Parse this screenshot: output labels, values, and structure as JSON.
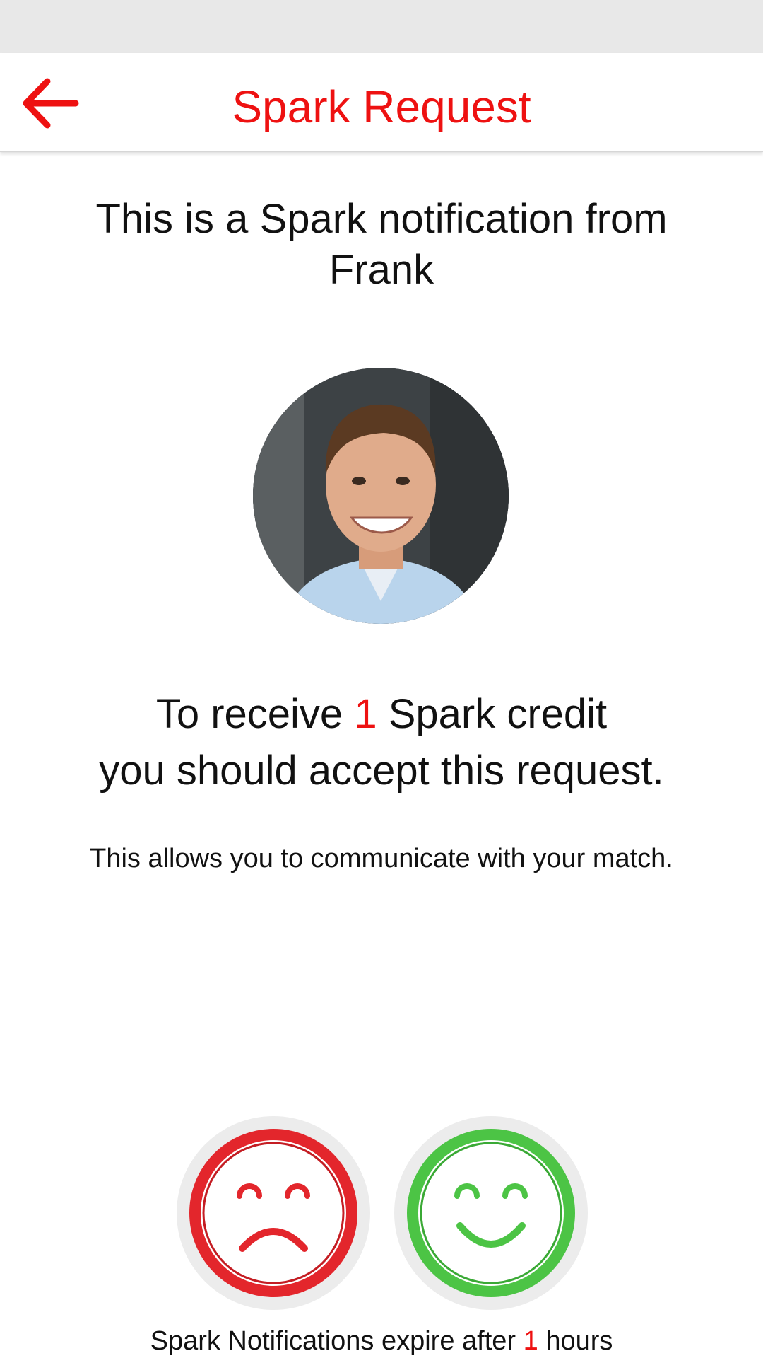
{
  "app_bar": {
    "title": "Spark Request",
    "back_icon": "arrow-left-icon",
    "accent_color": "#ee1111"
  },
  "main": {
    "heading": "This is a Spark notification from Frank",
    "avatar_icon": "profile-photo",
    "credit": {
      "prefix": "To receive ",
      "amount": "1",
      "suffix": " Spark credit",
      "line2": "you should accept this request."
    },
    "info": "This allows you to communicate with your match."
  },
  "actions": {
    "decline_icon": "sad-face-icon",
    "decline_color": "#e3262c",
    "accept_icon": "happy-face-icon",
    "accept_color": "#4cc445"
  },
  "footer": {
    "prefix": "Spark Notifications expire after ",
    "hours": "1",
    "suffix": " hours"
  }
}
